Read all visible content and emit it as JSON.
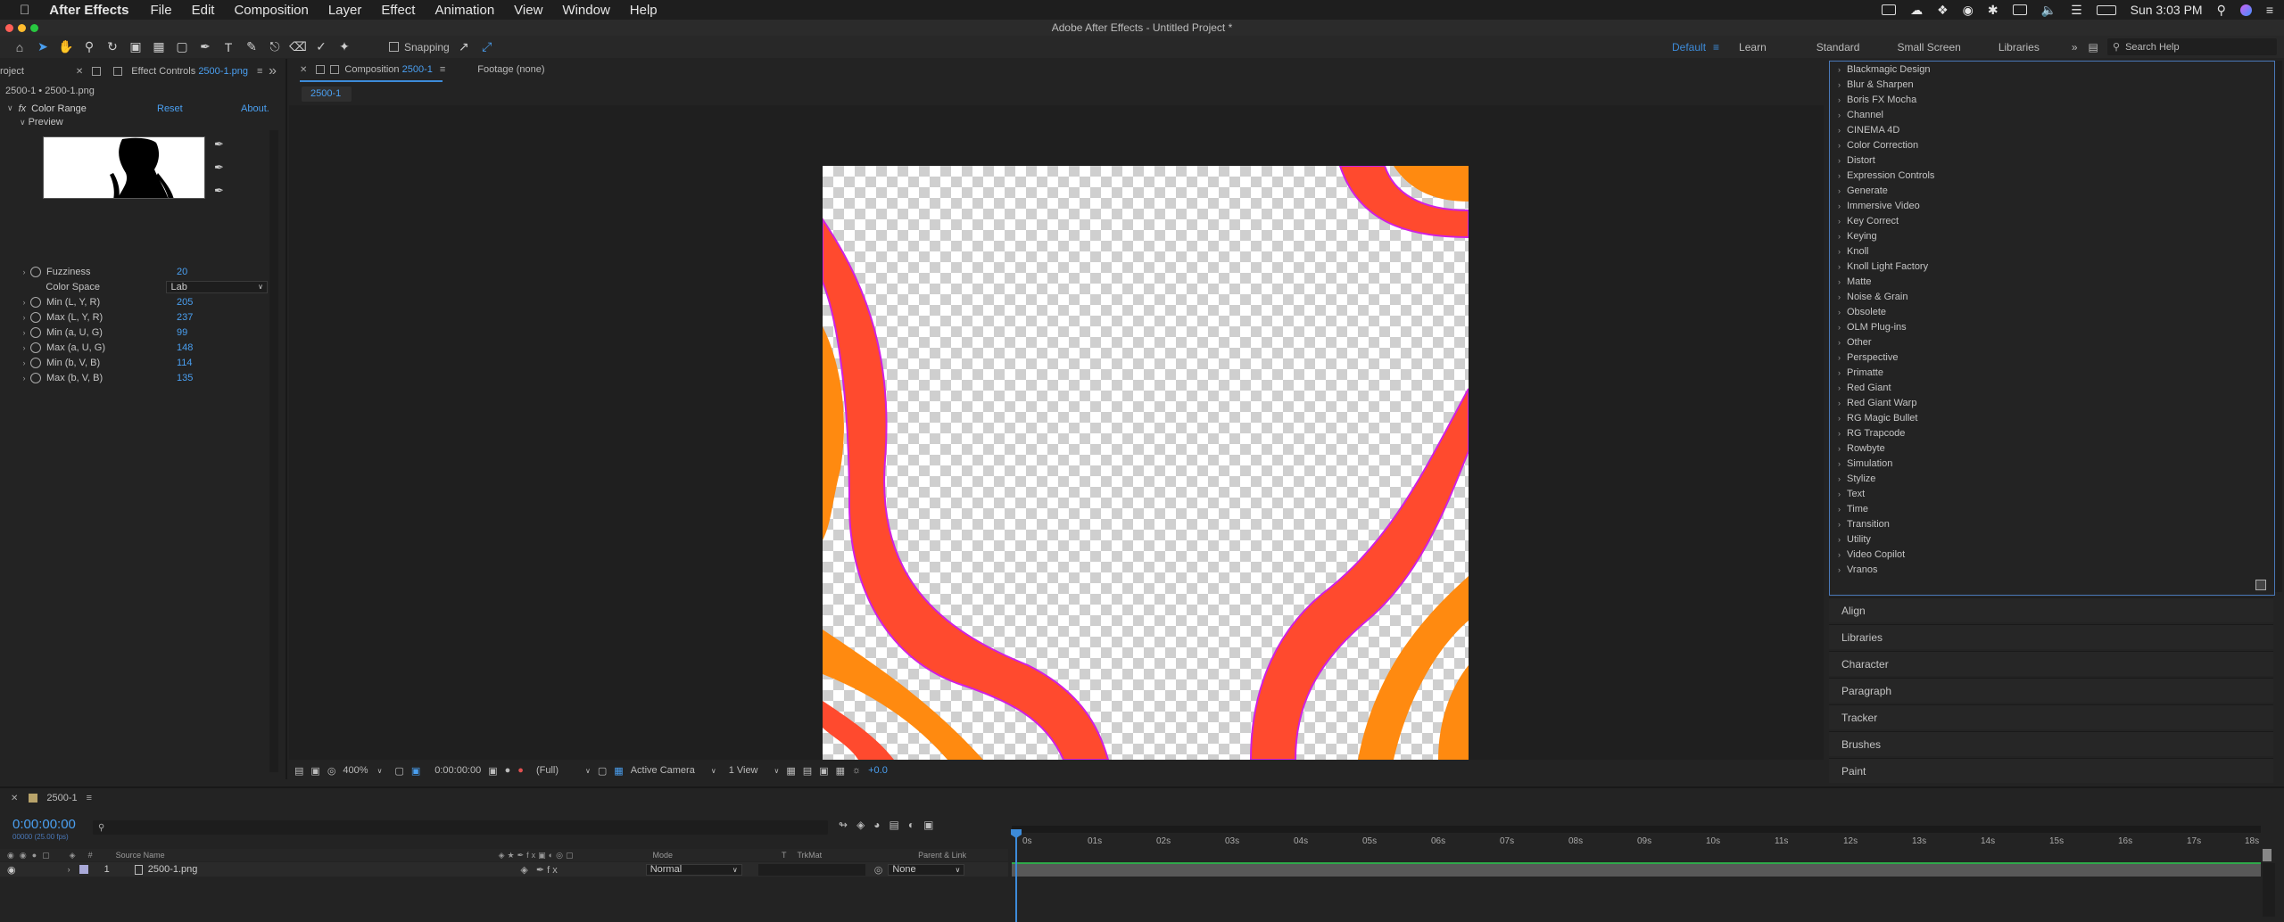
{
  "menubar": {
    "app_name": "After Effects",
    "items": [
      "File",
      "Edit",
      "Composition",
      "Layer",
      "Effect",
      "Animation",
      "View",
      "Window",
      "Help"
    ],
    "clock": "Sun 3:03 PM"
  },
  "window_title": "Adobe After Effects - Untitled Project *",
  "toolbar": {
    "snapping_label": "Snapping",
    "workspaces": [
      "Default",
      "Learn",
      "Standard",
      "Small Screen",
      "Libraries"
    ],
    "search_placeholder": "Search Help"
  },
  "left_panel": {
    "tab_project": "roject",
    "tab_effect_controls_prefix": "Effect Controls",
    "tab_effect_controls_file": "2500-1.png",
    "breadcrumb": "2500-1 • 2500-1.png",
    "effect_name": "Color Range",
    "reset_label": "Reset",
    "about_label": "About.",
    "preview_label": "Preview",
    "properties": [
      {
        "name": "Fuzziness",
        "value": "20"
      },
      {
        "name": "Color Space",
        "value": "Lab"
      },
      {
        "name": "Min (L, Y, R)",
        "value": "205"
      },
      {
        "name": "Max (L, Y, R)",
        "value": "237"
      },
      {
        "name": "Min (a, U, G)",
        "value": "99"
      },
      {
        "name": "Max (a, U, G)",
        "value": "148"
      },
      {
        "name": "Min (b, V, B)",
        "value": "114"
      },
      {
        "name": "Max (b, V, B)",
        "value": "135"
      }
    ]
  },
  "composition": {
    "tab_label_prefix": "Composition",
    "tab_label_name": "2500-1",
    "footage_tab": "Footage (none)",
    "subtab": "2500-1",
    "zoom": "400%",
    "timecode": "0:00:00:00",
    "resolution": "(Full)",
    "camera": "Active Camera",
    "views": "1 View",
    "exposure": "+0.0"
  },
  "effects_list": [
    "Blackmagic Design",
    "Blur & Sharpen",
    "Boris FX Mocha",
    "Channel",
    "CINEMA 4D",
    "Color Correction",
    "Distort",
    "Expression Controls",
    "Generate",
    "Immersive Video",
    "Key Correct",
    "Keying",
    "Knoll",
    "Knoll Light Factory",
    "Matte",
    "Noise & Grain",
    "Obsolete",
    "OLM Plug-ins",
    "Other",
    "Perspective",
    "Primatte",
    "Red Giant",
    "Red Giant Warp",
    "RG Magic Bullet",
    "RG Trapcode",
    "Rowbyte",
    "Simulation",
    "Stylize",
    "Text",
    "Time",
    "Transition",
    "Utility",
    "Video Copilot",
    "Vranos"
  ],
  "right_panels": [
    "Align",
    "Libraries",
    "Character",
    "Paragraph",
    "Tracker",
    "Brushes",
    "Paint"
  ],
  "timeline": {
    "tab_label": "2500-1",
    "timecode": "0:00:00:00",
    "fps": "00000 (25.00 fps)",
    "col_hash": "#",
    "col_source": "Source Name",
    "col_mode": "Mode",
    "col_t": "T",
    "col_trkmat": "TrkMat",
    "col_parent": "Parent & Link",
    "layer": {
      "index": "1",
      "name": "2500-1.png",
      "mode": "Normal",
      "parent": "None"
    },
    "ruler": [
      "0s",
      "01s",
      "02s",
      "03s",
      "04s",
      "05s",
      "06s",
      "07s",
      "08s",
      "09s",
      "10s",
      "11s",
      "12s",
      "13s",
      "14s",
      "15s",
      "16s",
      "17s",
      "18s"
    ]
  }
}
